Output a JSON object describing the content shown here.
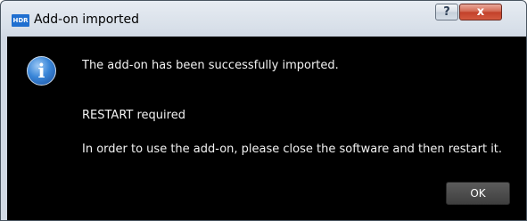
{
  "window": {
    "title": "Add-on imported",
    "app_icon_text": "HDR",
    "help_button_label": "?",
    "close_button_label": "x"
  },
  "message": {
    "line1": "The add-on has been successfully imported.",
    "line2": "RESTART required",
    "line3": "In order to use the add-on, please close the software and then restart it."
  },
  "buttons": {
    "ok_label": "OK"
  },
  "icons": {
    "info": "info-icon",
    "info_glyph": "i"
  },
  "colors": {
    "content_background": "#000000",
    "text": "#f2f2f2",
    "close_button": "#c2412b"
  }
}
